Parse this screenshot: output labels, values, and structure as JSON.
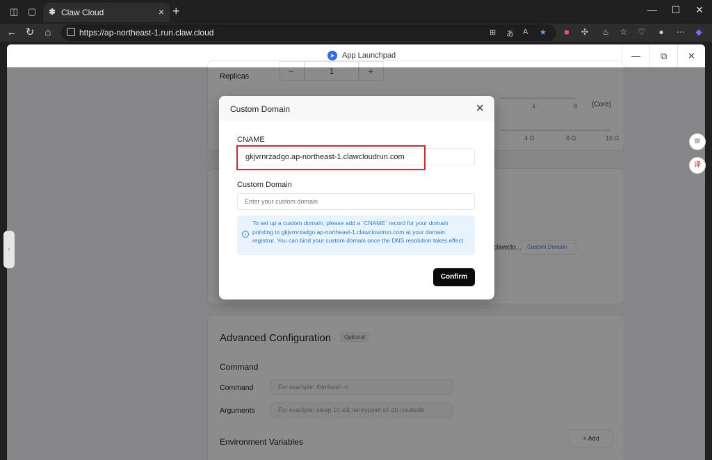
{
  "browser": {
    "tab_title": "Claw Cloud",
    "url": "https://ap-northeast-1.run.claw.cloud"
  },
  "app": {
    "title": "App Launchpad"
  },
  "background": {
    "replicas_label": "Replicas",
    "replicas_value": "1",
    "minus": "−",
    "plus": "+",
    "cpu_ticks": [
      "4",
      "8"
    ],
    "cpu_unit": "(Core)",
    "mem_ticks": [
      "4 G",
      "8 G",
      "16 G"
    ],
    "domain_text": "clawclo...",
    "custom_domain_link": "Custom Domain",
    "advanced_title": "Advanced Configuration",
    "optional_badge": "Optional",
    "command_section": "Command",
    "command_label": "Command",
    "command_placeholder": "For example: /bin/bash -c",
    "arguments_label": "Arguments",
    "arguments_placeholder": "For example: sleep 10 && /entrypoint.sh db createdb",
    "env_title": "Environment Variables",
    "add_label": "+ Add"
  },
  "modal": {
    "title": "Custom Domain",
    "cname_label": "CNAME",
    "cname_value": "gkjvrnrzadgo.ap-northeast-1.clawcloudrun.com",
    "domain_label": "Custom Domain",
    "domain_placeholder": "Enter your custom domain",
    "info_text": "To set up a custom domain, please add a `CNAME` record for your domain pointing to gkjvrnrzadgo.ap-northeast-1.clawcloudrun.com at your domain registrar. You can bind your custom domain once the DNS resolution takes effect.",
    "confirm_label": "Confirm"
  }
}
